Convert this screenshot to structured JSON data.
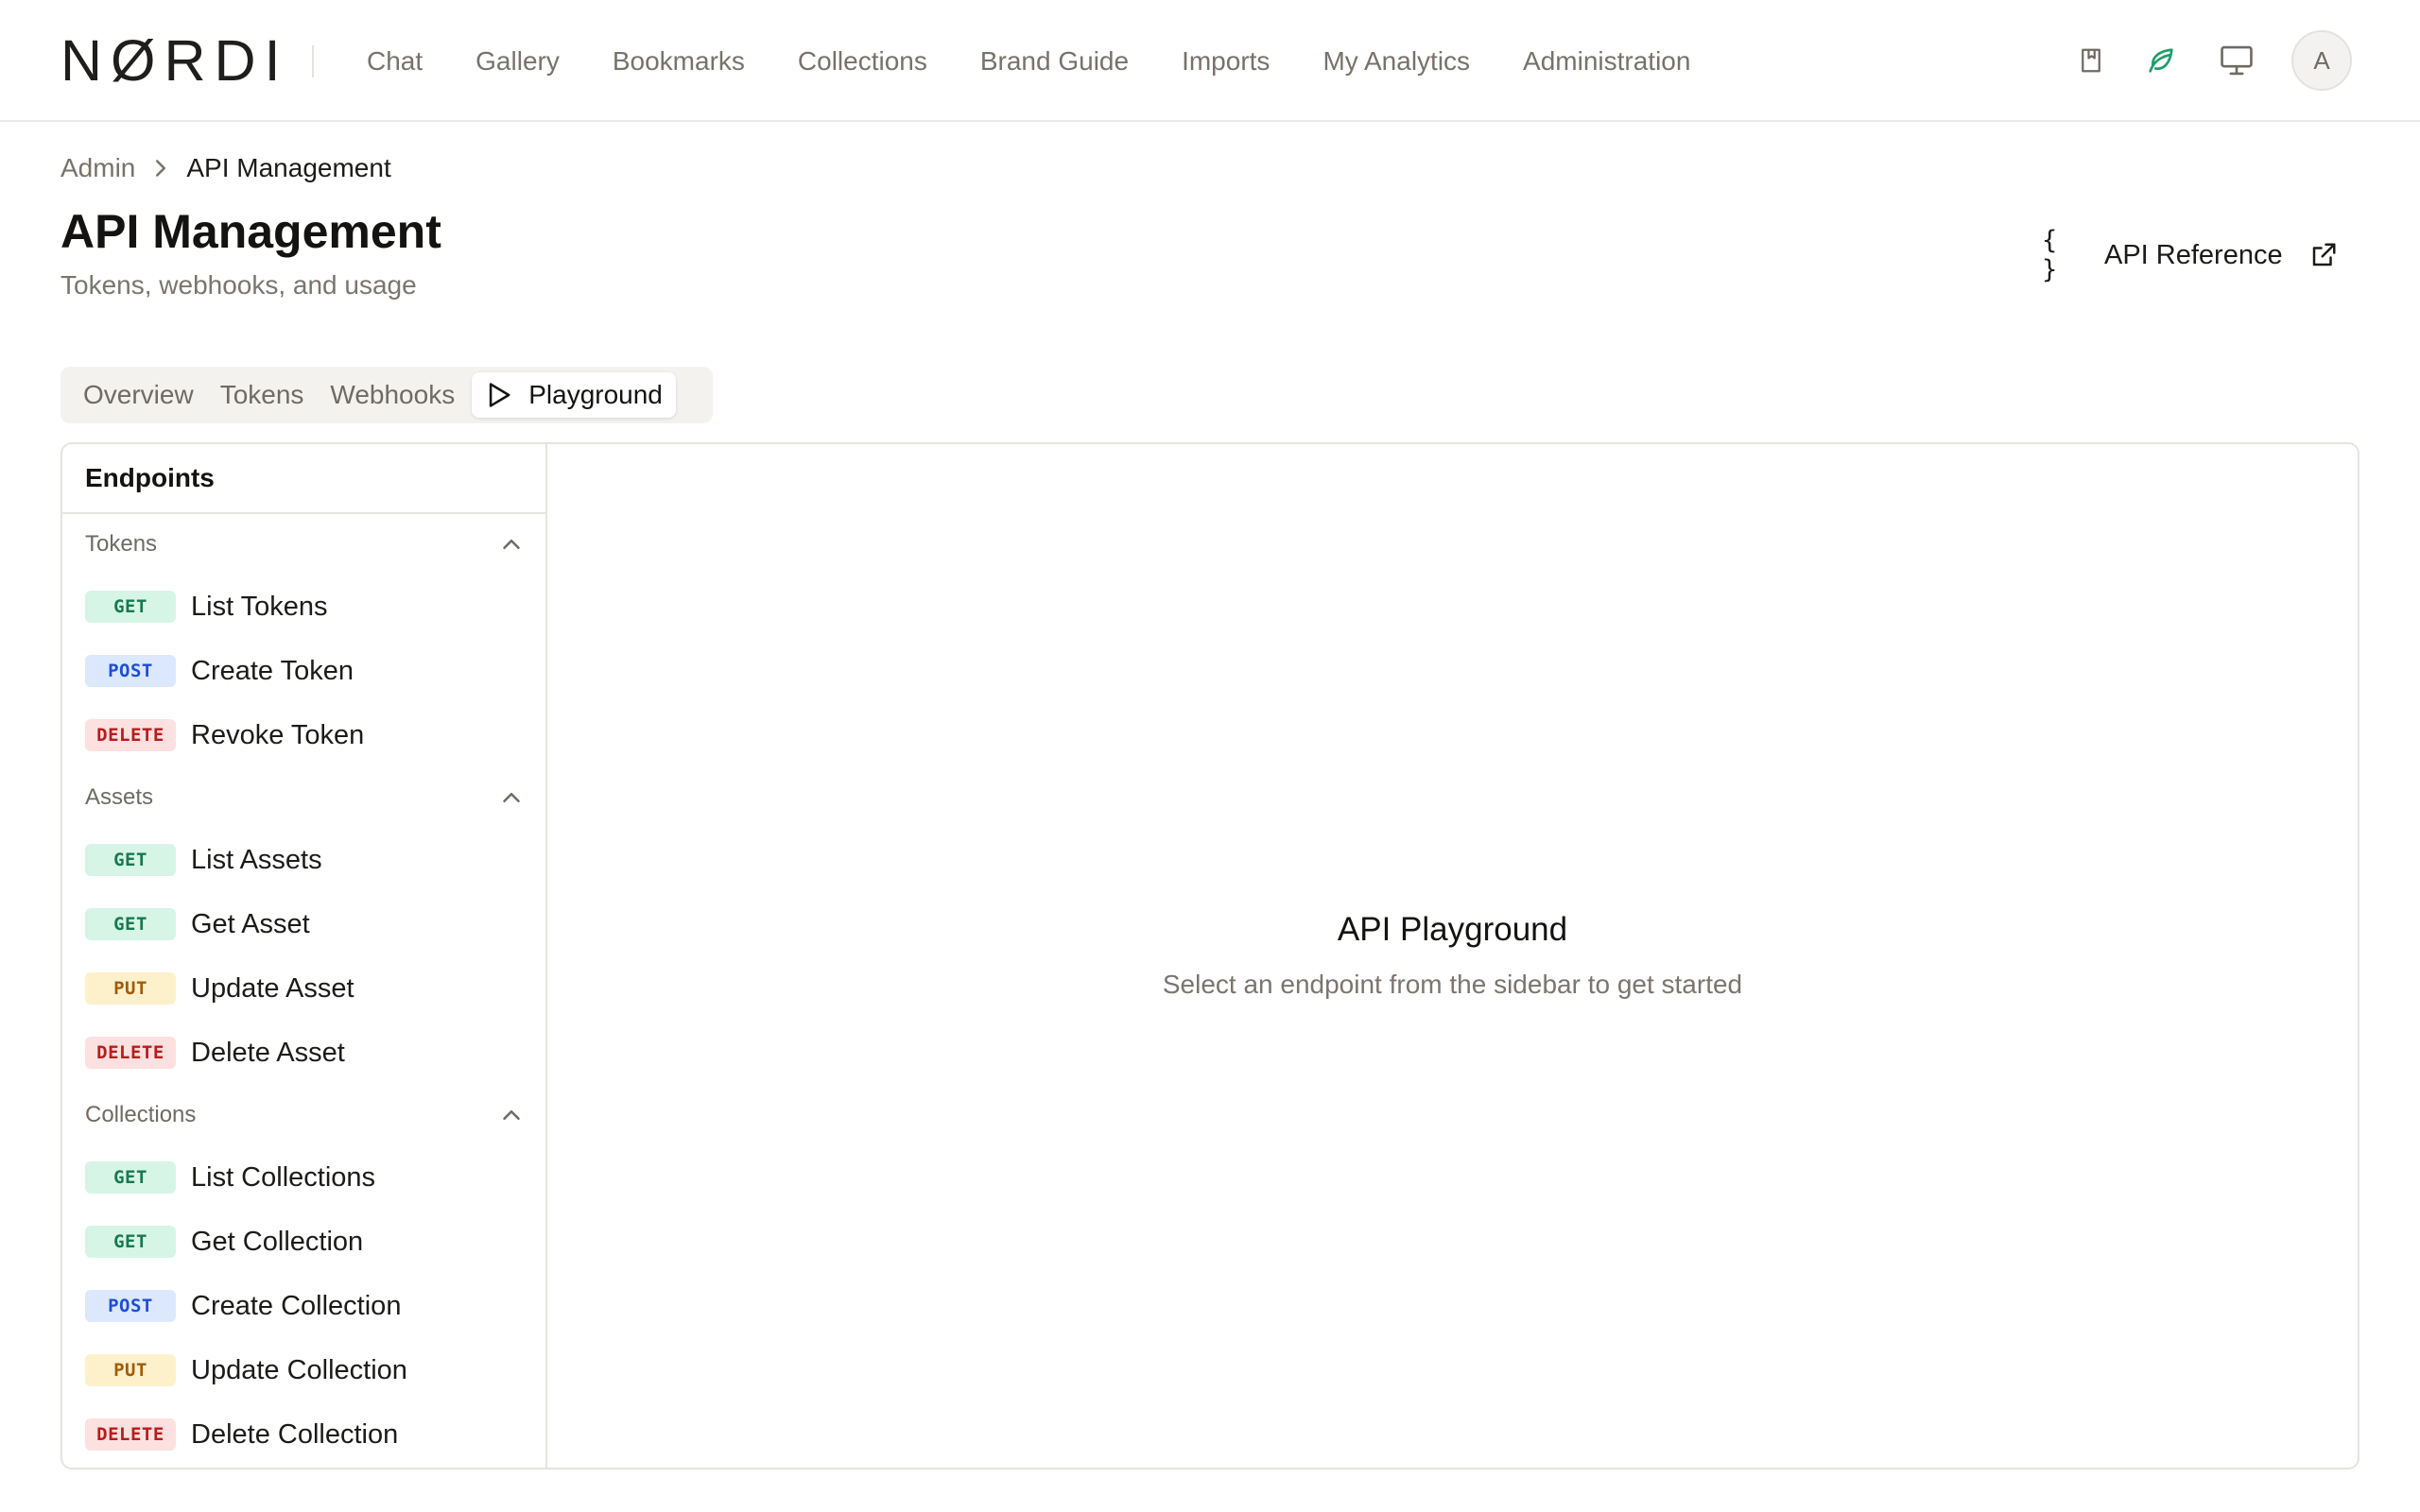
{
  "app": {
    "logo": "NØRDI",
    "nav": [
      "Chat",
      "Gallery",
      "Bookmarks",
      "Collections",
      "Brand Guide",
      "Imports",
      "My Analytics",
      "Administration"
    ],
    "icons": [
      "bookmark-book-icon",
      "leaf-icon",
      "monitor-icon"
    ],
    "avatar_initial": "A",
    "accent_color": "#1f9d6b"
  },
  "breadcrumb": {
    "root": "Admin",
    "current": "API Management"
  },
  "page": {
    "title": "API Management",
    "subtitle": "Tokens, webhooks, and usage",
    "api_ref_label": "API Reference",
    "api_ref_icon": "{ }"
  },
  "tabs": [
    "Overview",
    "Tokens",
    "Webhooks",
    "Playground"
  ],
  "active_tab": "Playground",
  "sidebar": {
    "title": "Endpoints",
    "groups": [
      {
        "name": "Tokens",
        "endpoints": [
          {
            "method": "GET",
            "label": "List Tokens"
          },
          {
            "method": "POST",
            "label": "Create Token"
          },
          {
            "method": "DELETE",
            "label": "Revoke Token"
          }
        ]
      },
      {
        "name": "Assets",
        "endpoints": [
          {
            "method": "GET",
            "label": "List Assets"
          },
          {
            "method": "GET",
            "label": "Get Asset"
          },
          {
            "method": "PUT",
            "label": "Update Asset"
          },
          {
            "method": "DELETE",
            "label": "Delete Asset"
          }
        ]
      },
      {
        "name": "Collections",
        "endpoints": [
          {
            "method": "GET",
            "label": "List Collections"
          },
          {
            "method": "GET",
            "label": "Get Collection"
          },
          {
            "method": "POST",
            "label": "Create Collection"
          },
          {
            "method": "PUT",
            "label": "Update Collection"
          },
          {
            "method": "DELETE",
            "label": "Delete Collection"
          }
        ]
      }
    ]
  },
  "method_colors": {
    "GET": {
      "bg": "#d6f5e6",
      "fg": "#16794d"
    },
    "POST": {
      "bg": "#dbe8fd",
      "fg": "#1d4ed8"
    },
    "PUT": {
      "bg": "#fdf1cc",
      "fg": "#a15c07"
    },
    "DELETE": {
      "bg": "#fde0e0",
      "fg": "#b91c1c"
    }
  },
  "playground": {
    "title": "API Playground",
    "subtitle": "Select an endpoint from the sidebar to get started"
  }
}
